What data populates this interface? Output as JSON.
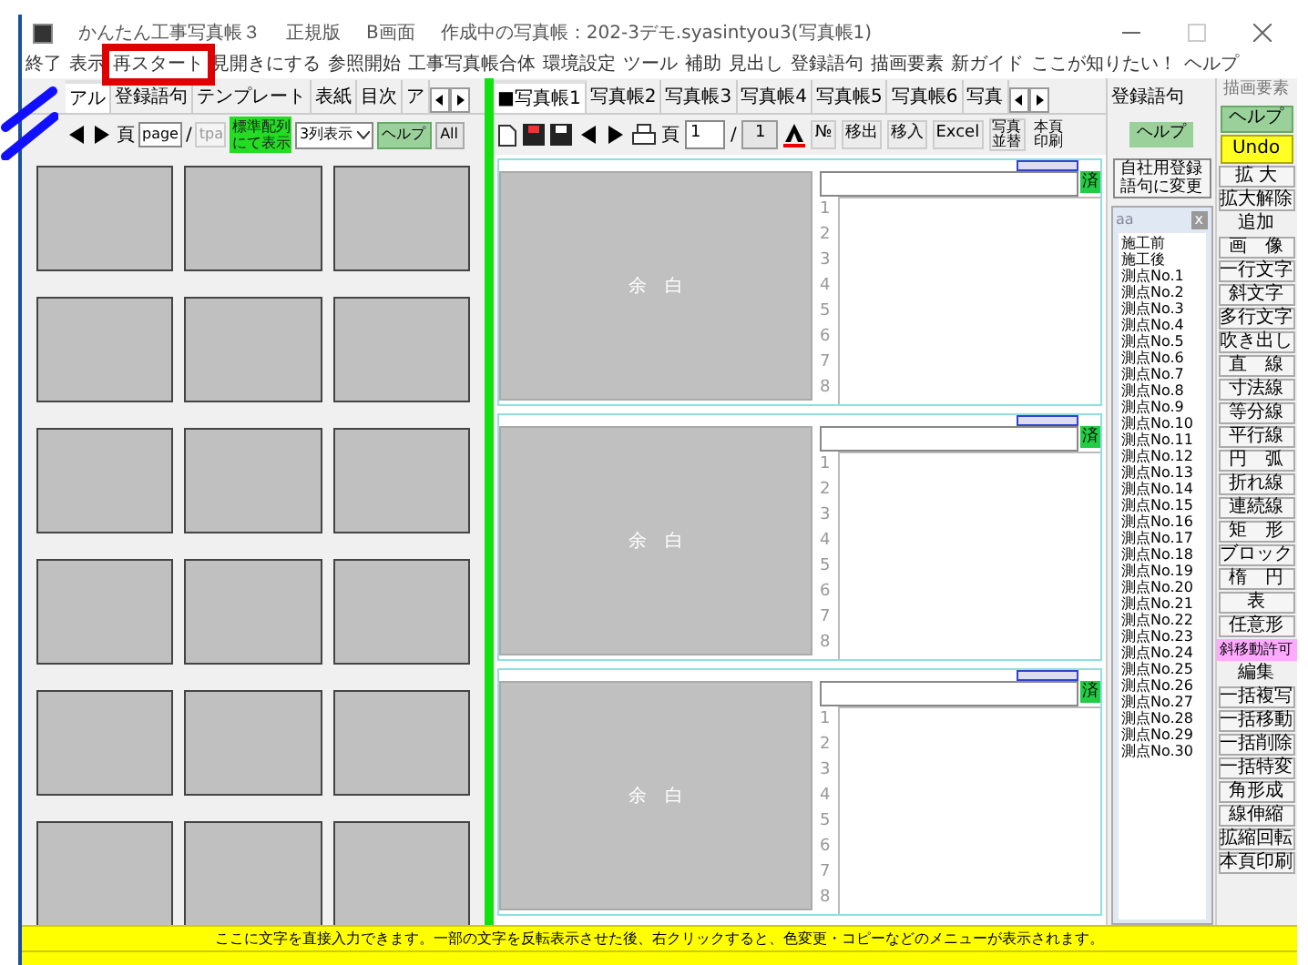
{
  "window": {
    "title": "かんたん工事写真帳３",
    "edition": "正規版",
    "screen": "B画面",
    "document": "作成中の写真帳：202-3デモ.syasintyou3(写真帳1)"
  },
  "menu": [
    {
      "label": "終了",
      "highlighted": false
    },
    {
      "label": "表示",
      "highlighted": false
    },
    {
      "label": "再スタート",
      "highlighted": true
    },
    {
      "label": "見開きにする",
      "highlighted": false
    },
    {
      "label": "参照開始",
      "highlighted": false
    },
    {
      "label": "工事写真帳合体",
      "highlighted": false
    },
    {
      "label": "環境設定",
      "highlighted": false
    },
    {
      "label": "ツール",
      "highlighted": false
    },
    {
      "label": "補助",
      "highlighted": false
    },
    {
      "label": "見出し",
      "highlighted": false
    },
    {
      "label": "登録語句",
      "highlighted": false
    },
    {
      "label": "描画要素",
      "highlighted": false
    },
    {
      "label": "新ガイド",
      "highlighted": false
    },
    {
      "label": "ここが知りたい！",
      "highlighted": false
    },
    {
      "label": "ヘルプ",
      "highlighted": false
    }
  ],
  "left_panel": {
    "tabs": [
      {
        "label": "アル",
        "selected": true
      },
      {
        "label": "登録語句",
        "selected": false
      },
      {
        "label": "テンプレート",
        "selected": false
      },
      {
        "label": "表紙",
        "selected": false
      },
      {
        "label": "目次",
        "selected": false
      },
      {
        "label": "ア",
        "selected": false
      }
    ],
    "page_label": "頁",
    "page_field": "page",
    "separator": "/",
    "tpa_field": "tpa",
    "arrange_button": "標準配列にて表示",
    "columns_select": "3列表示",
    "help_button": "ヘルプ",
    "all_button": "All"
  },
  "photo_book": {
    "tabs": [
      {
        "label": "■写真帳1",
        "selected": true
      },
      {
        "label": "写真帳2",
        "selected": false
      },
      {
        "label": "写真帳3",
        "selected": false
      },
      {
        "label": "写真帳4",
        "selected": false
      },
      {
        "label": "写真帳5",
        "selected": false
      },
      {
        "label": "写真帳6",
        "selected": false
      },
      {
        "label": "写真",
        "selected": false
      }
    ],
    "page_label": "頁",
    "page_value": "1",
    "separator": "/",
    "page_total": "1",
    "toolbar_buttons": [
      "№",
      "移出",
      "移入",
      "Excel"
    ],
    "sort_button": "写真並替",
    "print_button": "本頁印刷",
    "entries": [
      {
        "placeholder_text": "余　白",
        "status": "済",
        "line_numbers": [
          "1",
          "2",
          "3",
          "4",
          "5",
          "6",
          "7",
          "8"
        ]
      },
      {
        "placeholder_text": "余　白",
        "status": "済",
        "line_numbers": [
          "1",
          "2",
          "3",
          "4",
          "5",
          "6",
          "7",
          "8"
        ]
      },
      {
        "placeholder_text": "余　白",
        "status": "済",
        "line_numbers": [
          "1",
          "2",
          "3",
          "4",
          "5",
          "6",
          "7",
          "8"
        ]
      }
    ]
  },
  "phrases": {
    "title": "登録語句",
    "help_button": "ヘルプ",
    "switch_button": "自社用登録語句に変更",
    "list_title": "aa",
    "close": "x",
    "items": [
      "施工前",
      "施工後",
      "測点No.1",
      "測点No.2",
      "測点No.3",
      "測点No.4",
      "測点No.5",
      "測点No.6",
      "測点No.7",
      "測点No.8",
      "測点No.9",
      "測点No.10",
      "測点No.11",
      "測点No.12",
      "測点No.13",
      "測点No.14",
      "測点No.15",
      "測点No.16",
      "測点No.17",
      "測点No.18",
      "測点No.19",
      "測点No.20",
      "測点No.21",
      "測点No.22",
      "測点No.23",
      "測点No.24",
      "測点No.25",
      "測点No.26",
      "測点No.27",
      "測点No.28",
      "測点No.29",
      "測点No.30"
    ]
  },
  "drawing": {
    "title": "描画要素",
    "items": [
      {
        "kind": "help",
        "label": "ヘルプ"
      },
      {
        "kind": "undo",
        "label": "Undo"
      },
      {
        "kind": "button",
        "label": "拡 大"
      },
      {
        "kind": "button",
        "label": "拡大解除"
      },
      {
        "kind": "heading",
        "label": "追加"
      },
      {
        "kind": "button",
        "label": "画　像"
      },
      {
        "kind": "button",
        "label": "一行文字"
      },
      {
        "kind": "button",
        "label": "斜文字"
      },
      {
        "kind": "button",
        "label": "多行文字"
      },
      {
        "kind": "button",
        "label": "吹き出し"
      },
      {
        "kind": "button",
        "label": "直　線"
      },
      {
        "kind": "button",
        "label": "寸法線"
      },
      {
        "kind": "button",
        "label": "等分線"
      },
      {
        "kind": "button",
        "label": "平行線"
      },
      {
        "kind": "button",
        "label": "円　弧"
      },
      {
        "kind": "button",
        "label": "折れ線"
      },
      {
        "kind": "button",
        "label": "連続線"
      },
      {
        "kind": "button",
        "label": "矩　形"
      },
      {
        "kind": "button",
        "label": "ブロック"
      },
      {
        "kind": "button",
        "label": "楕　円"
      },
      {
        "kind": "button",
        "label": "表"
      },
      {
        "kind": "button",
        "label": "任意形"
      },
      {
        "kind": "toggle",
        "label": "斜移動許可"
      },
      {
        "kind": "heading",
        "label": "編集"
      },
      {
        "kind": "button",
        "label": "一括複写"
      },
      {
        "kind": "button",
        "label": "一括移動"
      },
      {
        "kind": "button",
        "label": "一括削除"
      },
      {
        "kind": "button",
        "label": "一括特変"
      },
      {
        "kind": "button",
        "label": "角形成"
      },
      {
        "kind": "button",
        "label": "線伸縮"
      },
      {
        "kind": "button",
        "label": "拡縮回転"
      },
      {
        "kind": "button",
        "label": "本頁印刷"
      }
    ]
  },
  "status_bar": "ここに文字を直接入力できます。一部の文字を反転表示させた後、右クリックすると、色変更・コピーなどのメニューが表示されます。"
}
